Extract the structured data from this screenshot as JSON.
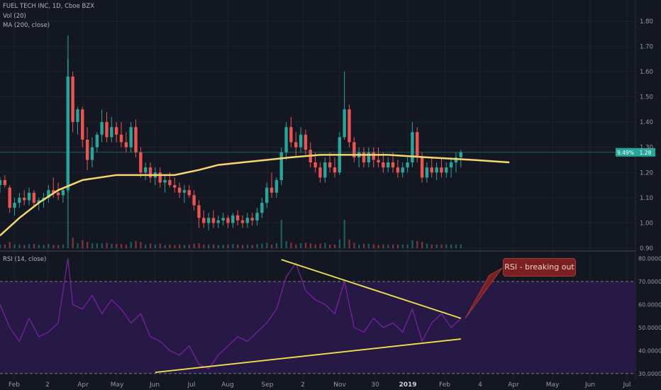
{
  "legend": {
    "symbol": "FUEL TECH INC, 1D, Cboe BZX",
    "vol": "Vol (20)",
    "ma": "MA (200, close)",
    "rsi": "RSI (14, close)"
  },
  "callout": "RSI - breaking out",
  "price_badge": {
    "change": "9.49%",
    "price": "1.28"
  },
  "colors": {
    "background": "#131722",
    "up": "#26a69a",
    "down": "#ef5350",
    "ma": "#f5d76e",
    "rsi_line": "#7b1fa2",
    "rsi_band": "#2a1a4a",
    "trendline": "#f2e24a",
    "badge": "#26a69a",
    "grid": "#1e2230"
  },
  "chart_data": [
    {
      "type": "candlestick",
      "title": "FUEL TECH INC, 1D, Cboe BZX",
      "y_ticks": [
        "0.90",
        "1.00",
        "1.10",
        "1.20",
        "1.30",
        "1.40",
        "1.50",
        "1.60",
        "1.70",
        "1.80"
      ],
      "ylim": [
        0.9,
        1.85
      ],
      "x_ticks": [
        "Feb",
        "2",
        "Apr",
        "May",
        "Jun",
        "Jul",
        "Aug",
        "Sep",
        "2",
        "Nov",
        "30",
        "2019",
        "Feb",
        "4",
        "Apr",
        "May",
        "Jun",
        "Jul"
      ],
      "last_price": 1.28,
      "series": [
        {
          "name": "MA (200, close)",
          "x": [
            0,
            8,
            16,
            24,
            34,
            48,
            60,
            72,
            82,
            90,
            100,
            110,
            120,
            132,
            146,
            160,
            176,
            195,
            210
          ],
          "values": [
            0.95,
            1.02,
            1.08,
            1.13,
            1.17,
            1.19,
            1.19,
            1.19,
            1.21,
            1.23,
            1.24,
            1.25,
            1.26,
            1.27,
            1.27,
            1.27,
            1.26,
            1.25,
            1.24
          ]
        }
      ],
      "ohlc": [
        [
          0,
          1.15,
          1.18,
          1.12,
          1.17
        ],
        [
          2,
          1.17,
          1.19,
          1.14,
          1.15
        ],
        [
          4,
          1.14,
          1.15,
          1.04,
          1.06
        ],
        [
          6,
          1.06,
          1.1,
          1.03,
          1.08
        ],
        [
          8,
          1.08,
          1.12,
          1.06,
          1.1
        ],
        [
          10,
          1.1,
          1.13,
          1.07,
          1.09
        ],
        [
          12,
          1.09,
          1.14,
          1.07,
          1.12
        ],
        [
          14,
          1.12,
          1.13,
          1.06,
          1.08
        ],
        [
          16,
          1.08,
          1.1,
          1.05,
          1.09
        ],
        [
          18,
          1.09,
          1.12,
          1.06,
          1.1
        ],
        [
          20,
          1.1,
          1.15,
          1.08,
          1.13
        ],
        [
          22,
          1.13,
          1.18,
          1.1,
          1.12
        ],
        [
          24,
          1.12,
          1.16,
          1.09,
          1.11
        ],
        [
          26,
          1.11,
          1.14,
          1.08,
          1.13
        ],
        [
          28,
          1.13,
          1.65,
          1.12,
          1.58
        ],
        [
          30,
          1.58,
          1.6,
          1.36,
          1.4
        ],
        [
          32,
          1.4,
          1.46,
          1.35,
          1.45
        ],
        [
          34,
          1.45,
          1.46,
          1.3,
          1.33
        ],
        [
          36,
          1.33,
          1.38,
          1.21,
          1.25
        ],
        [
          38,
          1.25,
          1.34,
          1.22,
          1.3
        ],
        [
          40,
          1.3,
          1.36,
          1.28,
          1.35
        ],
        [
          42,
          1.35,
          1.45,
          1.32,
          1.4
        ],
        [
          44,
          1.4,
          1.44,
          1.32,
          1.34
        ],
        [
          46,
          1.34,
          1.42,
          1.32,
          1.38
        ],
        [
          48,
          1.38,
          1.4,
          1.32,
          1.35
        ],
        [
          50,
          1.35,
          1.4,
          1.3,
          1.32
        ],
        [
          52,
          1.32,
          1.36,
          1.28,
          1.3
        ],
        [
          54,
          1.3,
          1.4,
          1.28,
          1.38
        ],
        [
          56,
          1.38,
          1.41,
          1.26,
          1.28
        ],
        [
          58,
          1.28,
          1.3,
          1.18,
          1.2
        ],
        [
          60,
          1.2,
          1.24,
          1.17,
          1.22
        ],
        [
          62,
          1.22,
          1.24,
          1.16,
          1.18
        ],
        [
          64,
          1.18,
          1.22,
          1.15,
          1.2
        ],
        [
          66,
          1.2,
          1.22,
          1.14,
          1.16
        ],
        [
          68,
          1.16,
          1.19,
          1.12,
          1.17
        ],
        [
          70,
          1.17,
          1.2,
          1.14,
          1.15
        ],
        [
          72,
          1.15,
          1.18,
          1.12,
          1.14
        ],
        [
          74,
          1.14,
          1.16,
          1.1,
          1.12
        ],
        [
          76,
          1.12,
          1.15,
          1.08,
          1.13
        ],
        [
          78,
          1.13,
          1.15,
          1.1,
          1.11
        ],
        [
          80,
          1.11,
          1.13,
          1.05,
          1.07
        ],
        [
          82,
          1.07,
          1.09,
          0.98,
          1.02
        ],
        [
          84,
          1.02,
          1.05,
          0.98,
          1.0
        ],
        [
          86,
          1.0,
          1.04,
          0.97,
          1.02
        ],
        [
          88,
          1.02,
          1.05,
          0.98,
          1.0
        ],
        [
          90,
          1.0,
          1.03,
          0.98,
          1.01
        ],
        [
          92,
          1.01,
          1.04,
          0.99,
          1.02
        ],
        [
          94,
          1.02,
          1.03,
          0.98,
          1.0
        ],
        [
          96,
          1.0,
          1.04,
          0.98,
          1.03
        ],
        [
          98,
          1.03,
          1.05,
          0.99,
          1.01
        ],
        [
          100,
          1.01,
          1.03,
          0.98,
          1.0
        ],
        [
          102,
          1.0,
          1.04,
          0.98,
          1.02
        ],
        [
          104,
          1.02,
          1.04,
          0.99,
          1.01
        ],
        [
          106,
          1.01,
          1.06,
          0.99,
          1.04
        ],
        [
          108,
          1.04,
          1.1,
          1.02,
          1.08
        ],
        [
          110,
          1.08,
          1.16,
          1.06,
          1.14
        ],
        [
          112,
          1.14,
          1.2,
          1.1,
          1.12
        ],
        [
          114,
          1.12,
          1.18,
          1.1,
          1.17
        ],
        [
          116,
          1.17,
          1.3,
          1.15,
          1.28
        ],
        [
          118,
          1.28,
          1.4,
          1.25,
          1.38
        ],
        [
          120,
          1.38,
          1.42,
          1.3,
          1.32
        ],
        [
          122,
          1.32,
          1.36,
          1.26,
          1.3
        ],
        [
          124,
          1.3,
          1.38,
          1.28,
          1.35
        ],
        [
          126,
          1.35,
          1.37,
          1.27,
          1.29
        ],
        [
          128,
          1.29,
          1.32,
          1.22,
          1.24
        ],
        [
          130,
          1.24,
          1.28,
          1.2,
          1.22
        ],
        [
          132,
          1.22,
          1.24,
          1.16,
          1.18
        ],
        [
          134,
          1.18,
          1.26,
          1.16,
          1.24
        ],
        [
          136,
          1.24,
          1.28,
          1.2,
          1.22
        ],
        [
          138,
          1.22,
          1.26,
          1.18,
          1.2
        ],
        [
          140,
          1.2,
          1.36,
          1.19,
          1.34
        ],
        [
          142,
          1.34,
          1.6,
          1.33,
          1.45
        ],
        [
          144,
          1.45,
          1.47,
          1.3,
          1.32
        ],
        [
          146,
          1.32,
          1.34,
          1.24,
          1.26
        ],
        [
          148,
          1.26,
          1.3,
          1.22,
          1.28
        ],
        [
          150,
          1.28,
          1.3,
          1.22,
          1.24
        ],
        [
          152,
          1.24,
          1.3,
          1.22,
          1.28
        ],
        [
          154,
          1.28,
          1.3,
          1.22,
          1.25
        ],
        [
          156,
          1.25,
          1.3,
          1.22,
          1.24
        ],
        [
          158,
          1.24,
          1.28,
          1.2,
          1.22
        ],
        [
          160,
          1.22,
          1.26,
          1.2,
          1.24
        ],
        [
          162,
          1.24,
          1.28,
          1.2,
          1.22
        ],
        [
          164,
          1.22,
          1.25,
          1.18,
          1.2
        ],
        [
          166,
          1.2,
          1.24,
          1.18,
          1.22
        ],
        [
          168,
          1.22,
          1.26,
          1.2,
          1.24
        ],
        [
          170,
          1.24,
          1.4,
          1.22,
          1.36
        ],
        [
          172,
          1.36,
          1.38,
          1.24,
          1.26
        ],
        [
          174,
          1.26,
          1.28,
          1.16,
          1.18
        ],
        [
          176,
          1.18,
          1.24,
          1.16,
          1.22
        ],
        [
          178,
          1.22,
          1.26,
          1.18,
          1.2
        ],
        [
          180,
          1.2,
          1.24,
          1.17,
          1.22
        ],
        [
          182,
          1.22,
          1.26,
          1.18,
          1.2
        ],
        [
          184,
          1.2,
          1.24,
          1.18,
          1.22
        ],
        [
          186,
          1.22,
          1.26,
          1.18,
          1.24
        ],
        [
          188,
          1.24,
          1.28,
          1.2,
          1.26
        ],
        [
          190,
          1.26,
          1.29,
          1.22,
          1.28
        ]
      ]
    },
    {
      "type": "line",
      "title": "RSI (14, close)",
      "y_ticks": [
        "30.0000",
        "40.0000",
        "50.0000",
        "60.0000",
        "70.0000",
        "80.0000"
      ],
      "ylim": [
        29,
        82
      ],
      "overbought": 70,
      "oversold": 30,
      "series": [
        {
          "name": "RSI (14, close)",
          "x": [
            0,
            4,
            8,
            12,
            16,
            20,
            24,
            28,
            30,
            34,
            38,
            42,
            46,
            50,
            54,
            58,
            62,
            66,
            70,
            74,
            78,
            82,
            86,
            90,
            94,
            98,
            102,
            106,
            110,
            114,
            118,
            122,
            126,
            130,
            134,
            138,
            142,
            146,
            150,
            154,
            158,
            162,
            166,
            170,
            174,
            178,
            182,
            186,
            190
          ],
          "values": [
            60,
            50,
            44,
            54,
            46,
            48,
            52,
            80,
            60,
            58,
            64,
            56,
            62,
            58,
            52,
            56,
            46,
            44,
            40,
            38,
            42,
            34,
            32,
            38,
            42,
            46,
            44,
            48,
            52,
            58,
            72,
            78,
            66,
            62,
            60,
            56,
            70,
            50,
            48,
            54,
            50,
            52,
            48,
            58,
            44,
            52,
            56,
            50,
            54
          ]
        },
        {
          "name": "upper trendline",
          "x": [
            116,
            190
          ],
          "values": [
            79.5,
            54
          ]
        },
        {
          "name": "lower trendline",
          "x": [
            64,
            190
          ],
          "values": [
            30.5,
            45
          ]
        }
      ]
    }
  ]
}
